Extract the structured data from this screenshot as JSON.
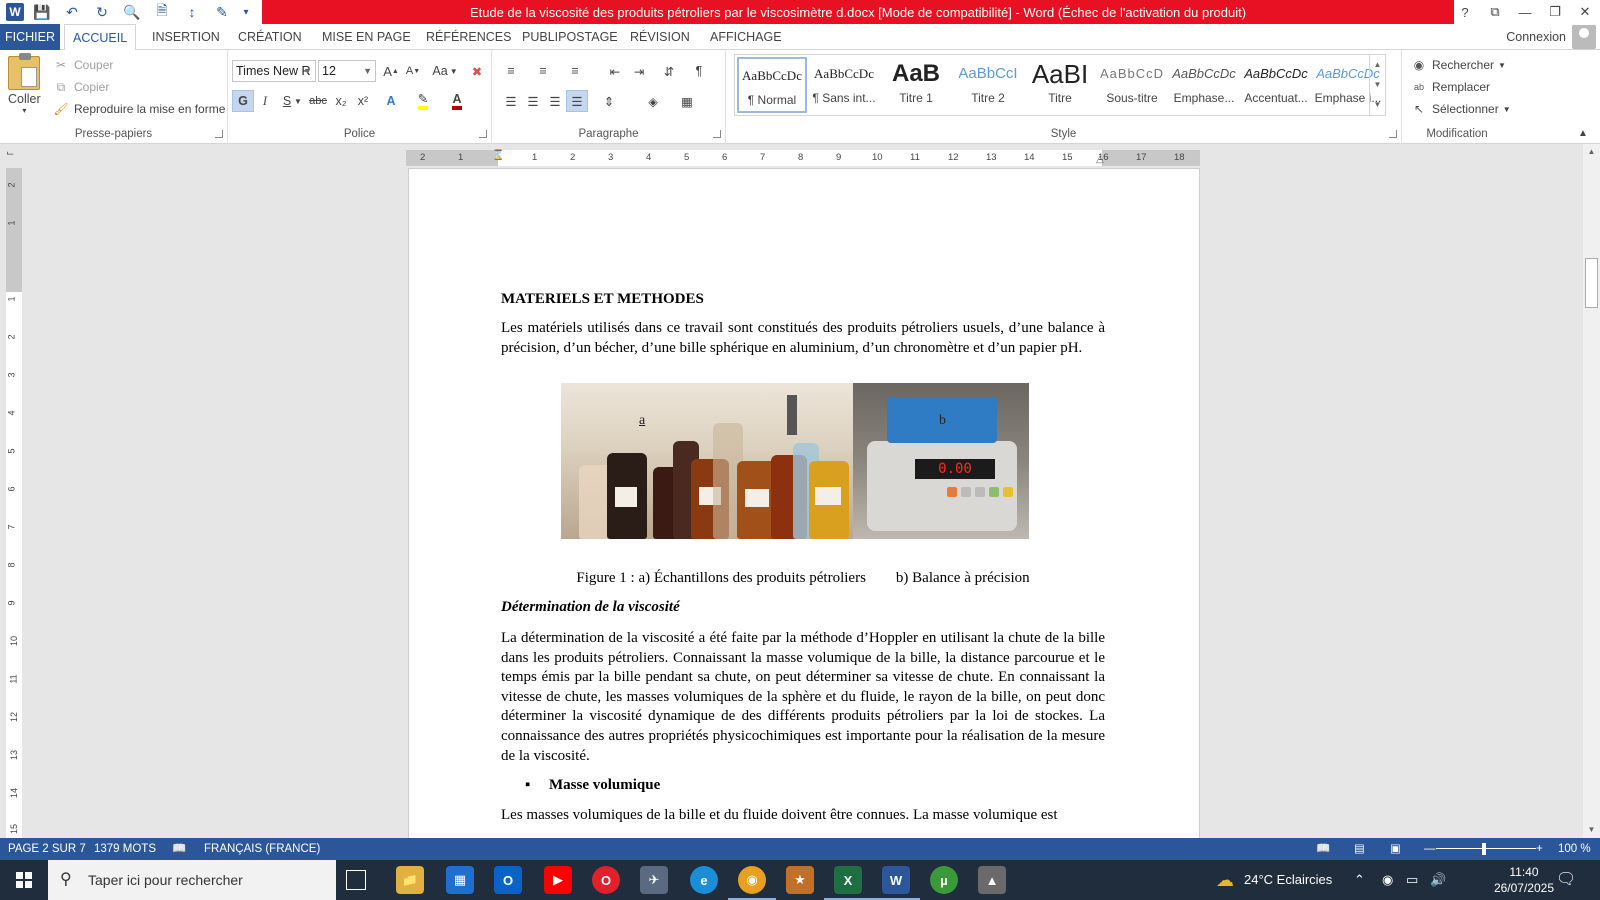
{
  "window": {
    "title": "Etude de la viscosité des produits pétroliers par le viscosimètre d.docx [Mode de compatibilité] -  Word (Échec de l'activation du produit)",
    "controls": [
      "?",
      "⧉",
      "—",
      "❐",
      "✕"
    ]
  },
  "tabs": {
    "file": "FICHIER",
    "items": [
      "ACCUEIL",
      "INSERTION",
      "CRÉATION",
      "MISE EN PAGE",
      "RÉFÉRENCES",
      "PUBLIPOSTAGE",
      "RÉVISION",
      "AFFICHAGE"
    ],
    "connexion": "Connexion"
  },
  "ribbon": {
    "clipboard": {
      "paste": "Coller",
      "cut": "Couper",
      "copy": "Copier",
      "format_painter": "Reproduire la mise en forme",
      "label": "Presse-papiers"
    },
    "font": {
      "family": "Times New R",
      "size": "12",
      "label": "Police",
      "bold": "G",
      "italic": "I",
      "underline": "S",
      "strike": "abc",
      "subscript": "x₂",
      "superscript": "x²",
      "grow": "A",
      "shrink": "A",
      "case": "Aa"
    },
    "paragraph": {
      "label": "Paragraphe",
      "pilcrow": "¶"
    },
    "styles": {
      "label": "Style",
      "items": [
        {
          "preview": "AaBbCcDc",
          "name": "¶ Normal"
        },
        {
          "preview": "AaBbCcDc",
          "name": "¶ Sans int..."
        },
        {
          "preview": "AaB",
          "name": "Titre 1"
        },
        {
          "preview": "AaBbCcI",
          "name": "Titre 2"
        },
        {
          "preview": "AaBI",
          "name": "Titre"
        },
        {
          "preview": "AaBbCcD",
          "name": "Sous-titre"
        },
        {
          "preview": "AaBbCcDc",
          "name": "Emphase..."
        },
        {
          "preview": "AaBbCcDc",
          "name": "Accentuat..."
        },
        {
          "preview": "AaBbCcDc",
          "name": "Emphase i..."
        }
      ]
    },
    "editing": {
      "label": "Modification",
      "find": "Rechercher",
      "replace": "Remplacer",
      "select": "Sélectionner"
    }
  },
  "ruler": {
    "h_ticks": [
      "2",
      "1",
      "1",
      "2",
      "3",
      "4",
      "5",
      "6",
      "7",
      "8",
      "9",
      "10",
      "11",
      "12",
      "13",
      "14",
      "15",
      "16",
      "17",
      "18"
    ],
    "v_ticks": [
      "2",
      "1",
      "1",
      "2",
      "3",
      "4",
      "5",
      "6",
      "7",
      "8",
      "9",
      "10",
      "11",
      "12",
      "13",
      "14",
      "15"
    ]
  },
  "document": {
    "heading": "MATERIELS ET METHODES",
    "intro": "Les matériels utilisés dans ce travail sont constitués des produits pétroliers usuels, d’une balance à précision, d’un bécher, d’une bille sphérique en aluminium, d’un chronomètre et d’un papier pH.",
    "image_a_label": "a",
    "image_b_label": "b",
    "scale_display": "0.00",
    "caption": "Figure 1 : a) Échantillons des produits pétroliers        b) Balance à précision",
    "subheading": "Détermination de la viscosité",
    "body": "La détermination de la viscosité a été faite par la méthode d’Hoppler en utilisant la chute de la bille dans les produits pétroliers. Connaissant la masse volumique de la bille, la distance parcourue et le temps émis par la bille pendant sa chute, on peut déterminer sa vitesse de chute. En connaissant la vitesse de chute, les masses volumiques de la sphère et du fluide, le rayon de la bille, on peut donc déterminer la viscosité dynamique de des différents produits pétroliers par la loi de stockes. La connaissance des autres propriétés physicochimiques est importante pour la réalisation de la mesure de la viscosité.",
    "bullet": "Masse volumique",
    "last_line": "Les masses volumiques de la bille et du fluide doivent être connues. La masse volumique est"
  },
  "status": {
    "page": "PAGE 2 SUR 7",
    "words": "1379 MOTS",
    "language": "FRANÇAIS (FRANCE)",
    "zoom": "100 %"
  },
  "taskbar": {
    "search_placeholder": "Taper ici pour rechercher",
    "weather": "24°C  Eclaircies",
    "time": "11:40",
    "date": "26/07/2025"
  },
  "colors": {
    "word_blue": "#2b579a",
    "title_red": "#e81123",
    "taskbar": "#1f2d3d"
  }
}
